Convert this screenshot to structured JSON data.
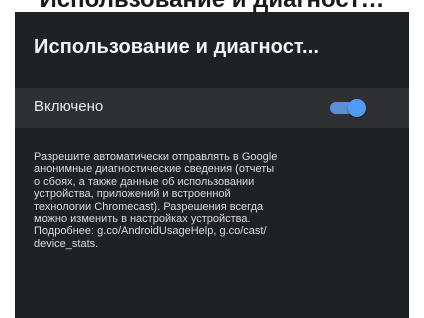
{
  "background_text": "Использование и диагност…",
  "title": "Использование и диагност...",
  "toggle": {
    "label": "Включено",
    "state": "on"
  },
  "description_lines": [
    "Разрешите автоматически отправлять в Google",
    "анонимные диагностические сведения (отчеты",
    "о сбоях, а также данные об использовании",
    "устройства, приложений и встроенной",
    "технологии Chromecast). Разрешения всегда",
    "можно изменить в настройках устройства.",
    "Подробнее: g.co/AndroidUsageHelp, g.co/cast/",
    "device_stats."
  ],
  "colors": {
    "panel": "#202124",
    "row": "#2f3033",
    "switch_thumb": "#4f9bf5",
    "switch_track": "#5b8fd6"
  }
}
